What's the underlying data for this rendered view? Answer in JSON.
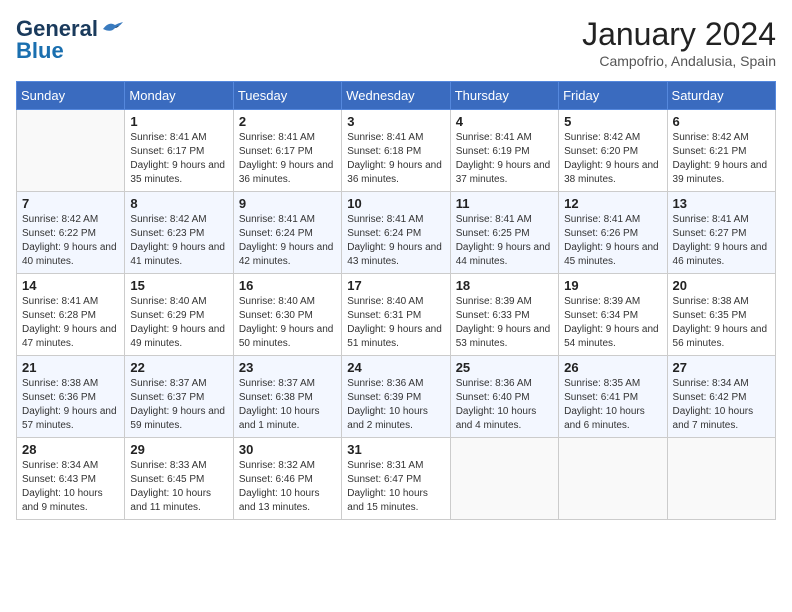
{
  "header": {
    "logo_general": "General",
    "logo_blue": "Blue",
    "month_year": "January 2024",
    "location": "Campofrio, Andalusia, Spain"
  },
  "weekdays": [
    "Sunday",
    "Monday",
    "Tuesday",
    "Wednesday",
    "Thursday",
    "Friday",
    "Saturday"
  ],
  "weeks": [
    [
      {
        "day": "",
        "sunrise": "",
        "sunset": "",
        "daylight": ""
      },
      {
        "day": "1",
        "sunrise": "Sunrise: 8:41 AM",
        "sunset": "Sunset: 6:17 PM",
        "daylight": "Daylight: 9 hours and 35 minutes."
      },
      {
        "day": "2",
        "sunrise": "Sunrise: 8:41 AM",
        "sunset": "Sunset: 6:17 PM",
        "daylight": "Daylight: 9 hours and 36 minutes."
      },
      {
        "day": "3",
        "sunrise": "Sunrise: 8:41 AM",
        "sunset": "Sunset: 6:18 PM",
        "daylight": "Daylight: 9 hours and 36 minutes."
      },
      {
        "day": "4",
        "sunrise": "Sunrise: 8:41 AM",
        "sunset": "Sunset: 6:19 PM",
        "daylight": "Daylight: 9 hours and 37 minutes."
      },
      {
        "day": "5",
        "sunrise": "Sunrise: 8:42 AM",
        "sunset": "Sunset: 6:20 PM",
        "daylight": "Daylight: 9 hours and 38 minutes."
      },
      {
        "day": "6",
        "sunrise": "Sunrise: 8:42 AM",
        "sunset": "Sunset: 6:21 PM",
        "daylight": "Daylight: 9 hours and 39 minutes."
      }
    ],
    [
      {
        "day": "7",
        "sunrise": "Sunrise: 8:42 AM",
        "sunset": "Sunset: 6:22 PM",
        "daylight": "Daylight: 9 hours and 40 minutes."
      },
      {
        "day": "8",
        "sunrise": "Sunrise: 8:42 AM",
        "sunset": "Sunset: 6:23 PM",
        "daylight": "Daylight: 9 hours and 41 minutes."
      },
      {
        "day": "9",
        "sunrise": "Sunrise: 8:41 AM",
        "sunset": "Sunset: 6:24 PM",
        "daylight": "Daylight: 9 hours and 42 minutes."
      },
      {
        "day": "10",
        "sunrise": "Sunrise: 8:41 AM",
        "sunset": "Sunset: 6:24 PM",
        "daylight": "Daylight: 9 hours and 43 minutes."
      },
      {
        "day": "11",
        "sunrise": "Sunrise: 8:41 AM",
        "sunset": "Sunset: 6:25 PM",
        "daylight": "Daylight: 9 hours and 44 minutes."
      },
      {
        "day": "12",
        "sunrise": "Sunrise: 8:41 AM",
        "sunset": "Sunset: 6:26 PM",
        "daylight": "Daylight: 9 hours and 45 minutes."
      },
      {
        "day": "13",
        "sunrise": "Sunrise: 8:41 AM",
        "sunset": "Sunset: 6:27 PM",
        "daylight": "Daylight: 9 hours and 46 minutes."
      }
    ],
    [
      {
        "day": "14",
        "sunrise": "Sunrise: 8:41 AM",
        "sunset": "Sunset: 6:28 PM",
        "daylight": "Daylight: 9 hours and 47 minutes."
      },
      {
        "day": "15",
        "sunrise": "Sunrise: 8:40 AM",
        "sunset": "Sunset: 6:29 PM",
        "daylight": "Daylight: 9 hours and 49 minutes."
      },
      {
        "day": "16",
        "sunrise": "Sunrise: 8:40 AM",
        "sunset": "Sunset: 6:30 PM",
        "daylight": "Daylight: 9 hours and 50 minutes."
      },
      {
        "day": "17",
        "sunrise": "Sunrise: 8:40 AM",
        "sunset": "Sunset: 6:31 PM",
        "daylight": "Daylight: 9 hours and 51 minutes."
      },
      {
        "day": "18",
        "sunrise": "Sunrise: 8:39 AM",
        "sunset": "Sunset: 6:33 PM",
        "daylight": "Daylight: 9 hours and 53 minutes."
      },
      {
        "day": "19",
        "sunrise": "Sunrise: 8:39 AM",
        "sunset": "Sunset: 6:34 PM",
        "daylight": "Daylight: 9 hours and 54 minutes."
      },
      {
        "day": "20",
        "sunrise": "Sunrise: 8:38 AM",
        "sunset": "Sunset: 6:35 PM",
        "daylight": "Daylight: 9 hours and 56 minutes."
      }
    ],
    [
      {
        "day": "21",
        "sunrise": "Sunrise: 8:38 AM",
        "sunset": "Sunset: 6:36 PM",
        "daylight": "Daylight: 9 hours and 57 minutes."
      },
      {
        "day": "22",
        "sunrise": "Sunrise: 8:37 AM",
        "sunset": "Sunset: 6:37 PM",
        "daylight": "Daylight: 9 hours and 59 minutes."
      },
      {
        "day": "23",
        "sunrise": "Sunrise: 8:37 AM",
        "sunset": "Sunset: 6:38 PM",
        "daylight": "Daylight: 10 hours and 1 minute."
      },
      {
        "day": "24",
        "sunrise": "Sunrise: 8:36 AM",
        "sunset": "Sunset: 6:39 PM",
        "daylight": "Daylight: 10 hours and 2 minutes."
      },
      {
        "day": "25",
        "sunrise": "Sunrise: 8:36 AM",
        "sunset": "Sunset: 6:40 PM",
        "daylight": "Daylight: 10 hours and 4 minutes."
      },
      {
        "day": "26",
        "sunrise": "Sunrise: 8:35 AM",
        "sunset": "Sunset: 6:41 PM",
        "daylight": "Daylight: 10 hours and 6 minutes."
      },
      {
        "day": "27",
        "sunrise": "Sunrise: 8:34 AM",
        "sunset": "Sunset: 6:42 PM",
        "daylight": "Daylight: 10 hours and 7 minutes."
      }
    ],
    [
      {
        "day": "28",
        "sunrise": "Sunrise: 8:34 AM",
        "sunset": "Sunset: 6:43 PM",
        "daylight": "Daylight: 10 hours and 9 minutes."
      },
      {
        "day": "29",
        "sunrise": "Sunrise: 8:33 AM",
        "sunset": "Sunset: 6:45 PM",
        "daylight": "Daylight: 10 hours and 11 minutes."
      },
      {
        "day": "30",
        "sunrise": "Sunrise: 8:32 AM",
        "sunset": "Sunset: 6:46 PM",
        "daylight": "Daylight: 10 hours and 13 minutes."
      },
      {
        "day": "31",
        "sunrise": "Sunrise: 8:31 AM",
        "sunset": "Sunset: 6:47 PM",
        "daylight": "Daylight: 10 hours and 15 minutes."
      },
      {
        "day": "",
        "sunrise": "",
        "sunset": "",
        "daylight": ""
      },
      {
        "day": "",
        "sunrise": "",
        "sunset": "",
        "daylight": ""
      },
      {
        "day": "",
        "sunrise": "",
        "sunset": "",
        "daylight": ""
      }
    ]
  ]
}
